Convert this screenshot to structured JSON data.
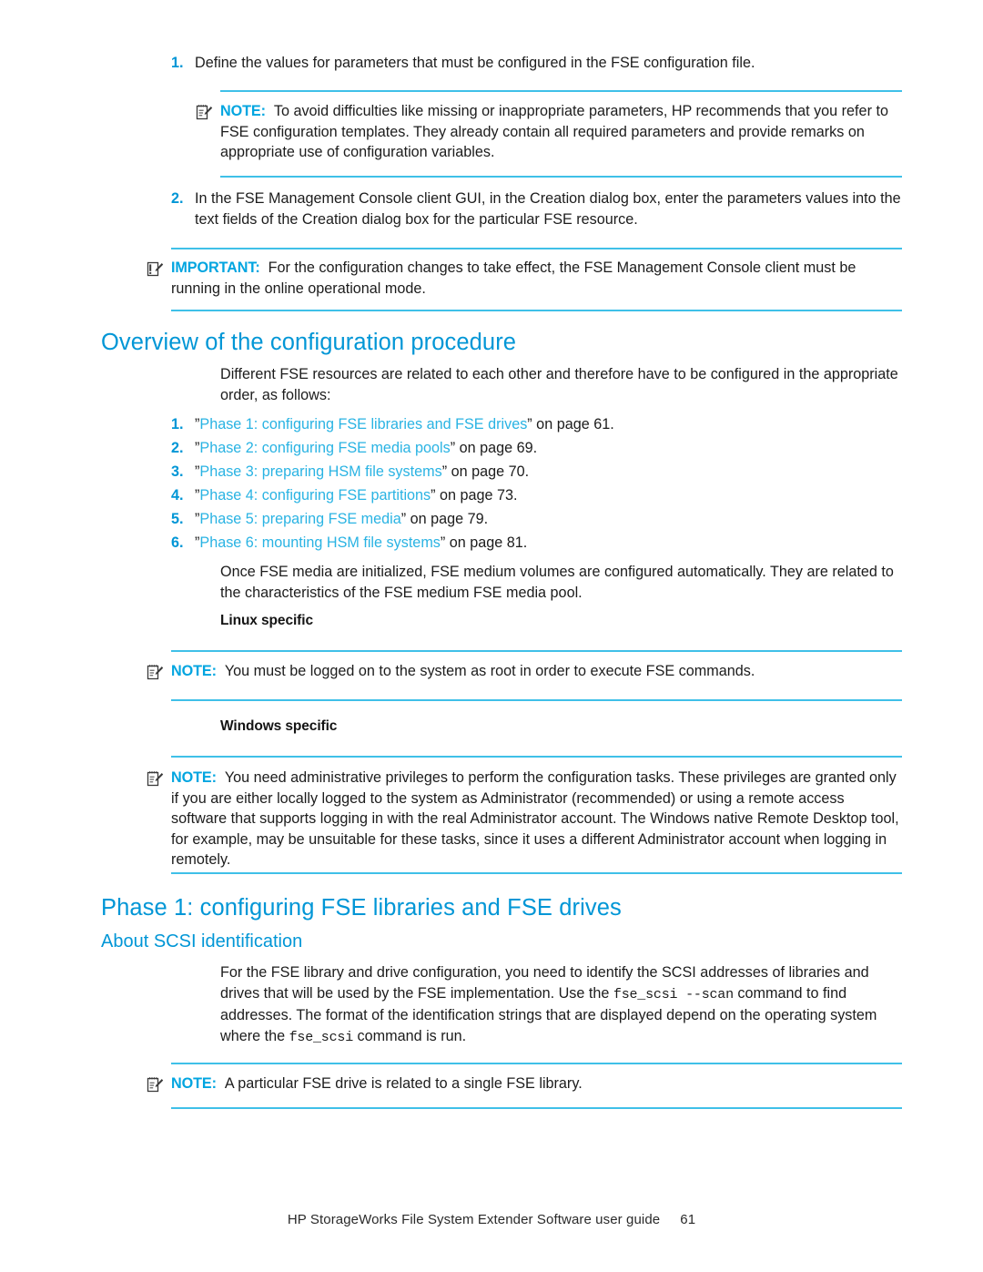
{
  "document": {
    "footer_text": "HP StorageWorks File System Extender Software user guide",
    "page_number": "61"
  },
  "colors": {
    "heading": "#0096d6",
    "link": "#29b3e3",
    "rule": "#3fc0e8",
    "label": "#00a5e0",
    "body": "#1c1c1c"
  },
  "steps": [
    {
      "number": "1.",
      "text": "Define the values for parameters that must be configured in the FSE configuration file."
    },
    {
      "number": "2.",
      "text": "In the FSE Management Console client GUI, in the Creation dialog box, enter the parameters values into the text fields of the Creation dialog box for the particular FSE resource."
    }
  ],
  "notes": {
    "note_templates": {
      "label": "NOTE:",
      "icon": "note-pad-pen-icon",
      "text": "To avoid difficulties like missing or inappropriate parameters, HP recommends that you refer to FSE configuration templates. They already contain all required parameters and provide remarks on appropriate use of configuration variables."
    },
    "important_online_mode": {
      "label": "IMPORTANT:",
      "icon": "important-pad-pen-icon",
      "text": "For the configuration changes to take effect, the FSE Management Console client must be running in the online operational mode."
    },
    "note_linux_root": {
      "label": "NOTE:",
      "icon": "note-pad-pen-icon",
      "text": "You must be logged on to the system as root in order to execute FSE commands."
    },
    "note_windows_admin": {
      "label": "NOTE:",
      "icon": "note-pad-pen-icon",
      "text": "You need administrative privileges to perform the configuration tasks. These privileges are granted only if you are either locally logged to the system as Administrator (recommended) or using a remote access software that supports logging in with the real Administrator account. The Windows native Remote Desktop tool, for example, may be unsuitable for these tasks, since it uses a different Administrator account when logging in remotely."
    },
    "note_drive_library": {
      "label": "NOTE:",
      "icon": "note-pad-pen-icon",
      "text": "A particular FSE drive is related to a single FSE library."
    }
  },
  "overview": {
    "heading": "Overview of the configuration procedure",
    "intro": "Different FSE resources are related to each other and therefore have to be configured in the appropriate order, as follows:",
    "phases": [
      {
        "number": "1.",
        "quote_open": "”",
        "link": "Phase 1: configuring FSE libraries and FSE drives",
        "quote_close": "”",
        "tail": " on page 61."
      },
      {
        "number": "2.",
        "quote_open": "”",
        "link": "Phase 2: configuring FSE media pools",
        "quote_close": "”",
        "tail": " on page 69."
      },
      {
        "number": "3.",
        "quote_open": "”",
        "link": "Phase 3: preparing HSM file systems",
        "quote_close": "”",
        "tail": " on page 70."
      },
      {
        "number": "4.",
        "quote_open": "”",
        "link": "Phase 4: configuring FSE partitions",
        "quote_close": "”",
        "tail": " on page 73."
      },
      {
        "number": "5.",
        "quote_open": "”",
        "link": "Phase 5: preparing FSE media",
        "quote_close": "”",
        "tail": " on page 79."
      },
      {
        "number": "6.",
        "quote_open": "”",
        "link": "Phase 6: mounting HSM file systems",
        "quote_close": "”",
        "tail": " on page 81."
      }
    ],
    "closing": "Once FSE media are initialized, FSE medium volumes are configured automatically. They are related to the characteristics of the FSE medium FSE media pool.",
    "linux_heading": "Linux specific",
    "windows_heading": "Windows specific"
  },
  "phase1": {
    "heading": "Phase 1: configuring FSE libraries and FSE drives",
    "subheading": "About SCSI identification",
    "paragraph_part1": "For the FSE library and drive configuration, you need to identify the SCSI addresses of libraries and drives that will be used by the FSE implementation. Use the ",
    "command1": "fse_scsi --scan",
    "paragraph_part2": " command to find addresses. The format of the identification strings that are displayed depend on the operating system where the ",
    "command2": "fse_scsi",
    "paragraph_part3": " command is run."
  }
}
